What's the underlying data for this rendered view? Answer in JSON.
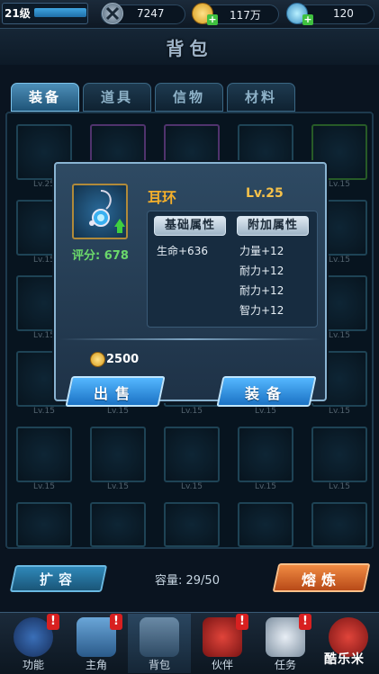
{
  "top_bar": {
    "level": "21级",
    "currency_1": "7247",
    "currency_2": "117万",
    "currency_3": "120"
  },
  "title": "背包",
  "tabs": [
    "装备",
    "道具",
    "信物",
    "材料"
  ],
  "grid_level_labels": [
    "Lv.25",
    "Lv.15",
    "Lv.15",
    "Lv.15",
    "Lv.15",
    "Lv.15",
    "Lv.15",
    "Lv.15",
    "Lv.15",
    "Lv.15",
    "Lv.15",
    "Lv.15",
    "Lv.15",
    "Lv.15",
    "Lv.15",
    "Lv.15",
    "Lv.15",
    "Lv.15",
    "Lv.15",
    "Lv.15"
  ],
  "modal": {
    "item_name": "耳环",
    "item_level": "Lv.25",
    "score": "评分: 678",
    "base_attr_tab": "基础属性",
    "extra_attr_tab": "附加属性",
    "base_attrs": [
      "生命+636"
    ],
    "extra_attrs": [
      "力量+12",
      "耐力+12",
      "耐力+12",
      "智力+12"
    ],
    "price": "2500",
    "sell_label": "出售",
    "equip_label": "装备"
  },
  "bottom": {
    "expand_label": "扩容",
    "capacity": "容量: 29/50",
    "smelt_label": "熔炼"
  },
  "nav": {
    "items": [
      "功能",
      "主角",
      "背包",
      "伙伴",
      "任务",
      ""
    ],
    "alert_mark": "!"
  },
  "watermark": "酷乐米",
  "colors": {
    "accent_blue": "#54b7ff",
    "gold_text": "#f5b02b",
    "score_green": "#6bd86b",
    "smelt_orange": "#f08a42"
  }
}
